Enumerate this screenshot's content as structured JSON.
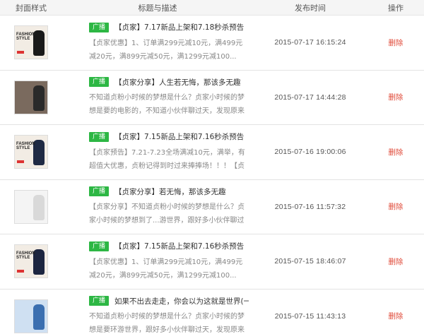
{
  "header": {
    "cover": "封面样式",
    "title": "标题与描述",
    "time": "发布时间",
    "op": "操作"
  },
  "rows": [
    {
      "badge": "广播",
      "title": "【贞家】7.17新品上架和7.18秒杀预告",
      "desc": "【贞家优惠】1、订单满299元减10元，满499元减20元，满899元减50元，满1299元减100...",
      "time": "2015-07-17 16:15:24",
      "action": "删除",
      "thumb": {
        "text": [
          "FASHION",
          "STYLE"
        ],
        "dress": "#1a1a1a",
        "bg": "#f2ece4"
      }
    },
    {
      "badge": "广播",
      "title": "【贞家分享】人生若无悔，那该多无趣",
      "desc": "不知道贞粉小时候的梦想是什么？贞家小时候的梦想是要的电影的，不知道小伙伴聊过天，发现原来大家小时候都...",
      "time": "2015-07-17 14:44:28",
      "action": "删除",
      "thumb": {
        "text": [],
        "dress": "#2a2a2a",
        "bg": "#7a6a5e"
      }
    },
    {
      "badge": "广播",
      "title": "【贞家】7.15新品上架和7.16秒杀预告",
      "desc": "【贞家预告】7.21-7.23全场满减10元，满举，有超值大优惠，贞粉记得到时过来捧捧场！！！【贞家优...",
      "time": "2015-07-16 19:00:06",
      "action": "删除",
      "thumb": {
        "text": [
          "FASHION",
          "STYLE"
        ],
        "dress": "#1f2a44",
        "bg": "#f2ece4"
      }
    },
    {
      "badge": "广播",
      "title": "【贞家分享】若无悔，那该多无趣",
      "desc": "【贞家分享】不知道贞粉小时候的梦想是什么？贞家小时候的梦想到了...游世界，跟好多小伙伴聊过天，发现原来...",
      "time": "2015-07-16 11:57:32",
      "action": "删除",
      "thumb": {
        "text": [],
        "dress": "#d9d9d9",
        "bg": "#f4f4f4"
      }
    },
    {
      "badge": "广播",
      "title": "【贞家】7.15新品上架和7.16秒杀预告",
      "desc": "【贞家优惠】1、订单满299元减10元，满499元减20元，满899元减50元，满1299元减100...",
      "time": "2015-07-15 18:46:07",
      "action": "删除",
      "thumb": {
        "text": [
          "FASHION",
          "STYLE"
        ],
        "dress": "#1c2540",
        "bg": "#f2ece4"
      }
    },
    {
      "badge": "广播",
      "title": "如果不出去走走，你会以为这就是世界(一)",
      "desc": "不知道贞粉小时候的梦想是什么？贞家小时候的梦想是要环游世界，跟好多小伙伴聊过天，发现原来大家小时候都...",
      "time": "2015-07-15 11:43:13",
      "action": "删除",
      "thumb": {
        "text": [],
        "dress": "#3b6fb0",
        "bg": "#cfe0f2"
      }
    }
  ],
  "colors": {
    "badge": "#2db744",
    "delete": "#e04b3a",
    "header_bg": "#f5f5f5"
  }
}
